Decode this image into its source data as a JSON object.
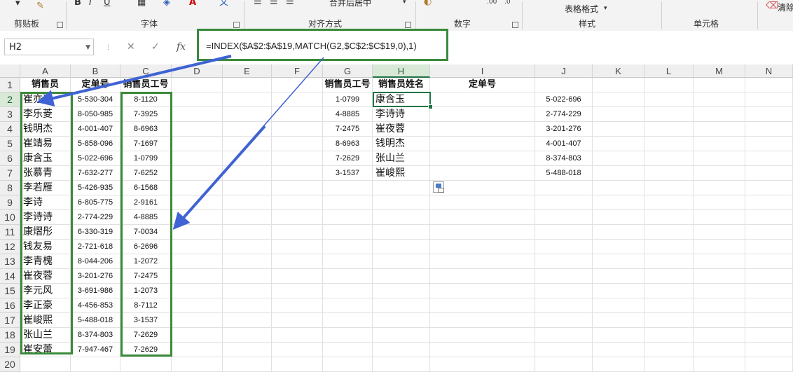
{
  "ribbon": {
    "groups": [
      {
        "label": "剪贴板"
      },
      {
        "label": "字体"
      },
      {
        "label": "对齐方式"
      },
      {
        "label": "数字"
      },
      {
        "label": "样式"
      },
      {
        "label": "单元格"
      }
    ],
    "merge_center_label": "合并后居中",
    "table_format_label": "表格格式",
    "clear_label": "清除"
  },
  "formula_bar": {
    "name_box": "H2",
    "fx": "fx",
    "formula": "=INDEX($A$2:$A$19,MATCH(G2,$C$2:$C$19,0),1)"
  },
  "columns": [
    "A",
    "B",
    "C",
    "D",
    "E",
    "F",
    "G",
    "H",
    "I",
    "J",
    "K",
    "L",
    "M",
    "N"
  ],
  "rows": [
    "1",
    "2",
    "3",
    "4",
    "5",
    "6",
    "7",
    "8",
    "9",
    "10",
    "11",
    "12",
    "13",
    "14",
    "15",
    "16",
    "17",
    "18",
    "19",
    "20"
  ],
  "sheet": {
    "headers": {
      "A1": "销售员",
      "B1": "定单号",
      "C1": "销售员工号",
      "G1": "销售员工号",
      "H1": "销售员姓名",
      "I1": "定单号"
    },
    "col_a": [
      "崔亦瑞",
      "李乐菱",
      "钱明杰",
      "崔靖易",
      "康含玉",
      "张慕青",
      "李若雁",
      "李诗",
      "李诗诗",
      "康熠彤",
      "钱友易",
      "李青槐",
      "崔夜蓉",
      "李元风",
      "李正豪",
      "崔峻熙",
      "张山兰",
      "崔安蕾"
    ],
    "col_b": [
      "5-530-304",
      "8-050-985",
      "4-001-407",
      "5-858-096",
      "5-022-696",
      "7-632-277",
      "5-426-935",
      "6-805-775",
      "2-774-229",
      "6-330-319",
      "2-721-618",
      "8-044-206",
      "3-201-276",
      "3-691-986",
      "4-456-853",
      "5-488-018",
      "8-374-803",
      "7-947-467"
    ],
    "col_c": [
      "8-1120",
      "7-3925",
      "8-6963",
      "7-1697",
      "1-0799",
      "7-6252",
      "6-1568",
      "2-9161",
      "4-8885",
      "7-0034",
      "6-2696",
      "1-2072",
      "7-2475",
      "1-2073",
      "8-7112",
      "3-1537",
      "7-2629",
      "7-2629"
    ],
    "col_g": [
      "1-0799",
      "4-8885",
      "7-2475",
      "8-6963",
      "7-2629",
      "3-1537"
    ],
    "col_h": [
      "康含玉",
      "李诗诗",
      "崔夜蓉",
      "钱明杰",
      "张山兰",
      "崔峻熙"
    ],
    "col_j": [
      "5-022-696",
      "2-774-229",
      "3-201-276",
      "4-001-407",
      "8-374-803",
      "5-488-018"
    ]
  },
  "colors": {
    "highlight_green": "#3a8a3a",
    "excel_green": "#217346",
    "arrow_blue": "#3f63d4"
  }
}
